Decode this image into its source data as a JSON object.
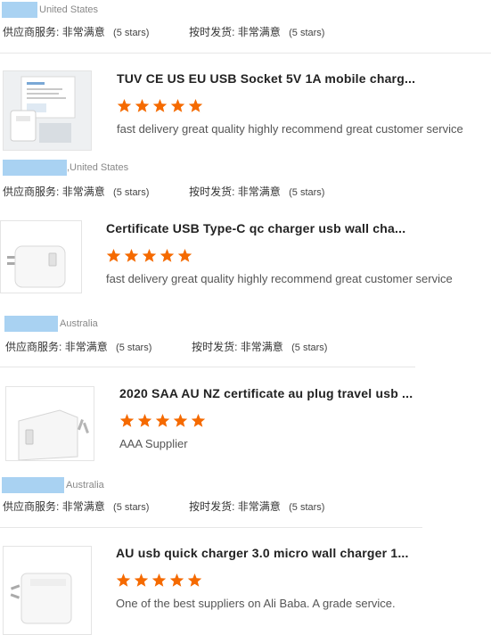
{
  "star_color": "#f56a00",
  "redaction_color": "#a9d2f2",
  "labels": {
    "supplier_service": "供应商服务:",
    "on_time_delivery": "按时发货:",
    "very_satisfied": "非常满意",
    "five_stars": "(5 stars)"
  },
  "reviews": [
    {
      "country": "United States",
      "title": null,
      "comment": null
    },
    {
      "country": ",United States",
      "title": "TUV CE US EU USB Socket 5V 1A mobile charg...",
      "comment": "fast delivery great quality highly recommend great customer service",
      "rating": "5"
    },
    {
      "country": "Australia",
      "title": "Certificate USB Type-C qc charger usb wall cha...",
      "comment": "fast delivery great quality highly recommend great customer service",
      "rating": "5"
    },
    {
      "country": "Australia",
      "title": "2020 SAA AU NZ certificate au plug travel usb ...",
      "comment": "AAA Supplier",
      "rating": "5"
    },
    {
      "country": null,
      "title": "AU usb quick charger 3.0 micro wall charger 1...",
      "comment": "One of the best suppliers on Ali Baba. A grade service.",
      "rating": "5"
    }
  ]
}
